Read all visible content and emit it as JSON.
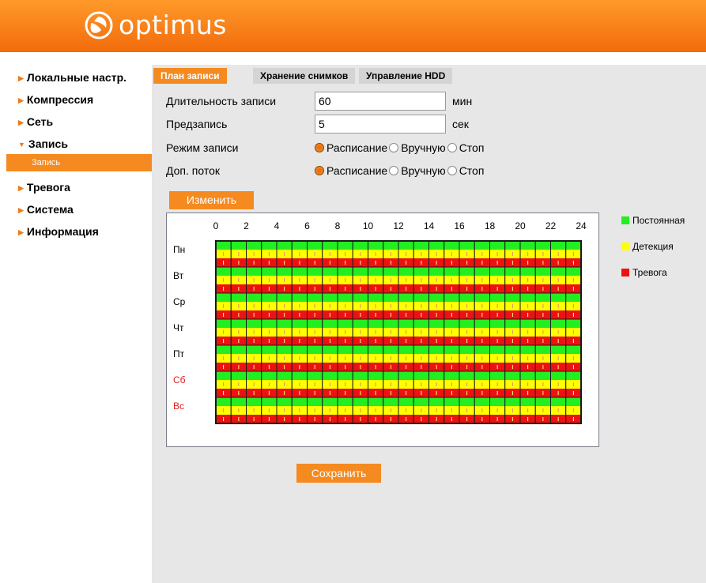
{
  "header": {
    "brand": "optimus"
  },
  "sidebar": {
    "items": [
      {
        "label": "Локальные настр."
      },
      {
        "label": "Компрессия"
      },
      {
        "label": "Сеть"
      },
      {
        "label": "Запись"
      },
      {
        "label": "Тревога"
      },
      {
        "label": "Система"
      },
      {
        "label": "Информация"
      }
    ],
    "sub_item": "Запись"
  },
  "tabs": [
    {
      "label": "План записи",
      "active": true
    },
    {
      "label": "Хранение снимков",
      "active": false
    },
    {
      "label": "Управление HDD",
      "active": false
    }
  ],
  "form": {
    "duration_label": "Длительность записи",
    "duration_value": "60",
    "duration_unit": "мин",
    "prerecord_label": "Предзапись",
    "prerecord_value": "5",
    "prerecord_unit": "сек",
    "mode_label": "Режим записи",
    "substream_label": "Доп. поток",
    "options": [
      "Расписание",
      "Вручную",
      "Стоп"
    ],
    "mode_selected": "Расписание",
    "substream_selected": "Расписание"
  },
  "buttons": {
    "change": "Изменить",
    "save": "Сохранить"
  },
  "schedule": {
    "hour_labels": [
      "0",
      "2",
      "4",
      "6",
      "8",
      "10",
      "12",
      "14",
      "16",
      "18",
      "20",
      "22",
      "24"
    ],
    "days": [
      {
        "label": "Пн",
        "weekend": false
      },
      {
        "label": "Вт",
        "weekend": false
      },
      {
        "label": "Ср",
        "weekend": false
      },
      {
        "label": "Чт",
        "weekend": false
      },
      {
        "label": "Пт",
        "weekend": false
      },
      {
        "label": "Сб",
        "weekend": true
      },
      {
        "label": "Вс",
        "weekend": true
      }
    ],
    "hours_per_day": 24,
    "fill": "all hours: Постоянная + Детекция + Тревога"
  },
  "legend": [
    {
      "label": "Постоянная",
      "color": "#22ee22"
    },
    {
      "label": "Детекция",
      "color": "#ffff00"
    },
    {
      "label": "Тревога",
      "color": "#ee1111"
    }
  ],
  "colors": {
    "accent": "#f58a20",
    "weekend_text": "#e02020",
    "grid_border": "#1a1a1a"
  }
}
